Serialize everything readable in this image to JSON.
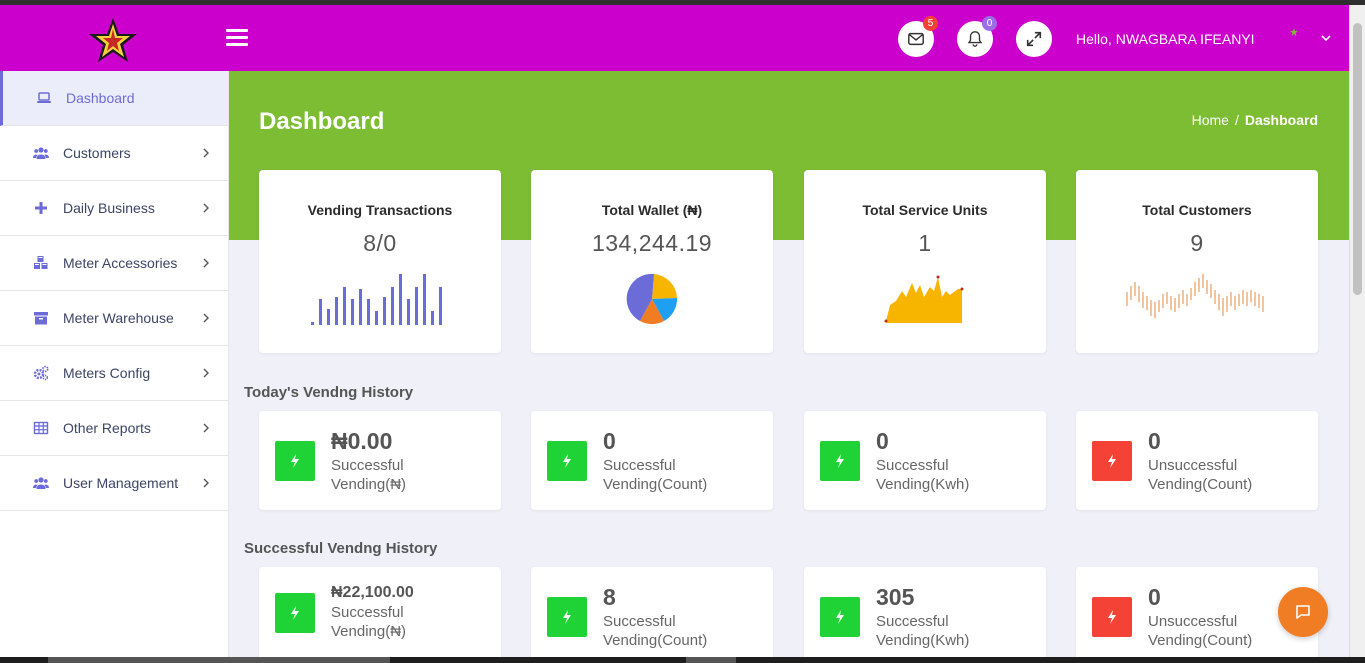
{
  "header": {
    "menu_icon": "hamburger-icon",
    "mail_badge": "5",
    "notif_badge": "0",
    "hello": "Hello,",
    "user_name": "NWAGBARA IFEANYI",
    "colors": {
      "header_bg": "#cc00cc",
      "band_bg": "#7cbd33",
      "mail_badge": "#f44336",
      "notif_badge": "#9c6ee6"
    }
  },
  "sidebar": {
    "items": [
      {
        "label": "Dashboard",
        "icon": "laptop-icon"
      },
      {
        "label": "Customers",
        "icon": "users-icon"
      },
      {
        "label": "Daily Business",
        "icon": "plus-icon"
      },
      {
        "label": "Meter Accessories",
        "icon": "cubes-icon"
      },
      {
        "label": "Meter Warehouse",
        "icon": "archive-icon"
      },
      {
        "label": "Meters Config",
        "icon": "cogs-icon"
      },
      {
        "label": "Other Reports",
        "icon": "table-icon"
      },
      {
        "label": "User Management",
        "icon": "users-icon"
      }
    ]
  },
  "page": {
    "title": "Dashboard",
    "breadcrumb": {
      "home": "Home",
      "sep": "/",
      "current": "Dashboard"
    }
  },
  "stats": [
    {
      "title": "Vending Transactions",
      "value": "8/0"
    },
    {
      "title": "Total Wallet (₦)",
      "value": "134,244.19"
    },
    {
      "title": "Total Service Units",
      "value": "1"
    },
    {
      "title": "Total Customers",
      "value": "9"
    }
  ],
  "today": {
    "title": "Today's Vendng History",
    "cards": [
      {
        "value": "₦0.00",
        "line1": "Successful",
        "line2": "Vending(₦)",
        "status": "success"
      },
      {
        "value": "0",
        "line1": "Successful",
        "line2": "Vending(Count)",
        "status": "success"
      },
      {
        "value": "0",
        "line1": "Successful",
        "line2": "Vending(Kwh)",
        "status": "success"
      },
      {
        "value": "0",
        "line1": "Unsuccessful",
        "line2": "Vending(Count)",
        "status": "fail"
      }
    ]
  },
  "successful": {
    "title": "Successful Vendng History",
    "cards": [
      {
        "value": "₦22,100.00",
        "line1": "Successful",
        "line2": "Vending(₦)",
        "status": "success"
      },
      {
        "value": "8",
        "line1": "Successful",
        "line2": "Vending(Count)",
        "status": "success"
      },
      {
        "value": "305",
        "line1": "Successful",
        "line2": "Vending(Kwh)",
        "status": "success"
      },
      {
        "value": "0",
        "line1": "Unsuccessful",
        "line2": "Vending(Count)",
        "status": "fail"
      }
    ]
  },
  "chat_icon": "chat-icon"
}
